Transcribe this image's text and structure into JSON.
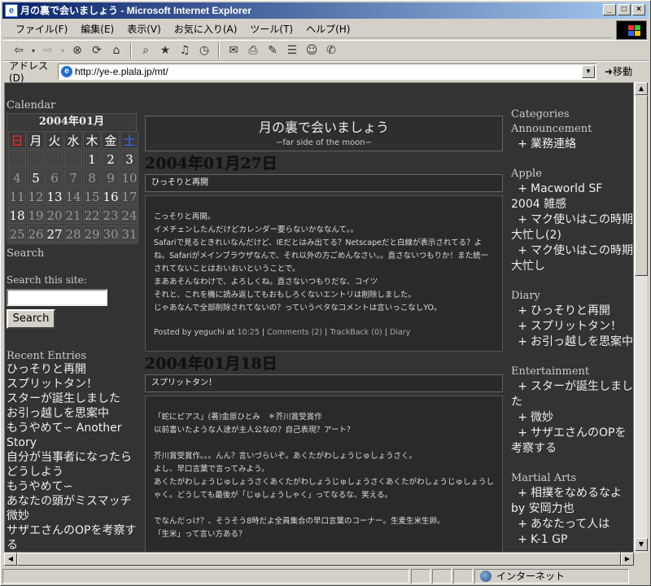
{
  "window": {
    "title": "月の裏で会いましょう - Microsoft Internet Explorer",
    "menu": [
      "ファイル(F)",
      "編集(E)",
      "表示(V)",
      "お気に入り(A)",
      "ツール(T)",
      "ヘルプ(H)"
    ],
    "address_label": "アドレス(D)",
    "url": "http://ye-e.plala.jp/mt/",
    "go_label": "移動",
    "status_zone": "インターネット"
  },
  "sidebar": {
    "calendar_heading": "Calendar",
    "calendar_title": "2004年01月",
    "weekdays": [
      "日",
      "月",
      "火",
      "水",
      "木",
      "金",
      "土"
    ],
    "days": [
      [
        "",
        "",
        "",
        "",
        "1",
        "2",
        "3"
      ],
      [
        "4",
        "5",
        "6",
        "7",
        "8",
        "9",
        "10"
      ],
      [
        "11",
        "12",
        "13",
        "14",
        "15",
        "16",
        "17"
      ],
      [
        "18",
        "19",
        "20",
        "21",
        "22",
        "23",
        "24"
      ],
      [
        "25",
        "26",
        "27",
        "28",
        "29",
        "30",
        "31"
      ]
    ],
    "search_heading": "Search",
    "search_label": "Search this site:",
    "search_button": "Search",
    "recent_heading": "Recent Entries",
    "recent": [
      "ひっそりと再開",
      "スプリットタン！",
      "スターが誕生しました",
      "お引っ越しを思案中",
      "もうやめて∽ Another Story",
      "自分が当事者になったらどうしよう",
      "もうやめて∽",
      "あなたの頭がミスマッチ微妙",
      "サザエさんのOPを考察する"
    ]
  },
  "blog": {
    "title": "月の裏で会いましょう",
    "subtitle": "∽far side of the moon∽",
    "entries": [
      {
        "date": "2004年01月27日",
        "title": "ひっそりと再開",
        "paragraphs": [
          "こっそりと再開。",
          "イメチェンしたんだけどカレンダー要らないかななんて。。",
          "Safariで見るときれいなんだけど、IEだとはみ出てる？Netscapeだと白線が表示されてる？よね。Safariがメインブラウザなんで、それ以外の方ごめんなさい。。直さないつもりか！また統一されてないことはおいおいということで。",
          "まああそんなわけで、よろしくね。直さないつもりだな、コイツ",
          "それと、これを機に読み返してもおもしろくないエントリは削除しました。",
          "じゃあなんで全部削除されてないの？っていうベタなコメントは言いっこなしYO。"
        ],
        "posted_by": "Posted by",
        "author": "yeguchi",
        "at": "at",
        "time": "10:25",
        "comments": "Comments (2)",
        "trackback": "TrackBack (0)",
        "category": "Diary"
      },
      {
        "date": "2004年01月18日",
        "title": "スプリットタン！",
        "paragraphs": [
          "「蛇にピアス」(著)金原ひとみ　＊芥川賞受賞作",
          "以前書いたような人達が主人公なの？自己表現？アート？",
          "",
          "芥川賞受賞作。。。んん？言いづらいぞ。あくたがわしょうじゅしょうさく。",
          "よし、早口言葉で言ってみよう。",
          "あくたがわしょうじゅしょうさくあくたがわしょうじゅしょうさくあくたがわしょうじゅしょうしゃく。どうしても最後が「じゅしょうしゃく」ってなるな、笑える。",
          "",
          "でなんだっけ？、そうそう8時だよ全員集合の早口言葉のコーナー。生麦生米生卵。",
          "「生米」って言い方ある？"
        ]
      }
    ]
  },
  "categories": {
    "heading": "Categories",
    "groups": [
      {
        "name": "Announcement",
        "items": [
          "業務連絡"
        ]
      },
      {
        "name": "Apple",
        "items": [
          "Macworld SF 2004 雑感",
          "マク使いはこの時期大忙し(2)",
          "マク使いはこの時期大忙し"
        ]
      },
      {
        "name": "Diary",
        "items": [
          "ひっそりと再開",
          "スプリットタン！",
          "お引っ越しを思案中"
        ]
      },
      {
        "name": "Entertainment",
        "items": [
          "スターが誕生しました",
          "微妙",
          "サザエさんのOPを考察する"
        ]
      },
      {
        "name": "Martial Arts",
        "items": [
          "相撲をなめるなよ by 安岡力也",
          "あなたって人は",
          "K-1 GP"
        ]
      }
    ]
  },
  "colors": {
    "page_bg": "#333333",
    "sunday": "#ff2222",
    "saturday": "#3b6cff",
    "titlebar_start": "#0a246a",
    "titlebar_end": "#a6caf0"
  }
}
